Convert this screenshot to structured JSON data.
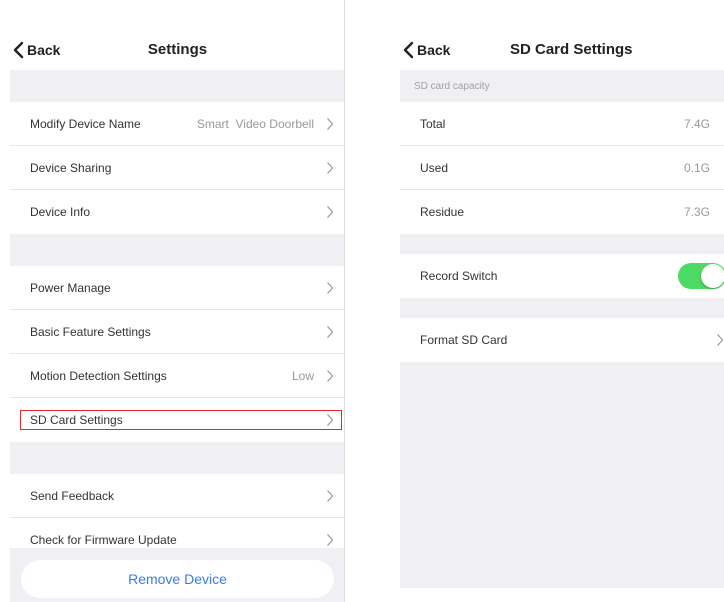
{
  "settings": {
    "back_label": "Back",
    "title": "Settings",
    "items": [
      {
        "label": "Modify Device Name",
        "value": "Smart  Video Doorbell"
      },
      {
        "label": "Device Sharing",
        "value": ""
      },
      {
        "label": "Device Info",
        "value": ""
      },
      {
        "label": "Power Manage",
        "value": ""
      },
      {
        "label": "Basic Feature Settings",
        "value": ""
      },
      {
        "label": "Motion Detection Settings",
        "value": "Low"
      },
      {
        "label": "SD Card Settings",
        "value": ""
      },
      {
        "label": "Send Feedback",
        "value": ""
      },
      {
        "label": "Check for Firmware Update",
        "value": ""
      }
    ],
    "remove_label": "Remove Device"
  },
  "sd_card": {
    "back_label": "Back",
    "title": "SD Card Settings",
    "capacity_header": "SD card capacity",
    "capacity": [
      {
        "label": "Total",
        "value": "7.4G"
      },
      {
        "label": "Used",
        "value": "0.1G"
      },
      {
        "label": "Residue",
        "value": "7.3G"
      }
    ],
    "record_switch_label": "Record Switch",
    "record_switch_on": true,
    "format_label": "Format SD Card"
  },
  "colors": {
    "accent": "#3b7ddd",
    "toggle_on": "#4cd964",
    "highlight_border": "#e3252c",
    "section_bg": "#efeff4"
  }
}
